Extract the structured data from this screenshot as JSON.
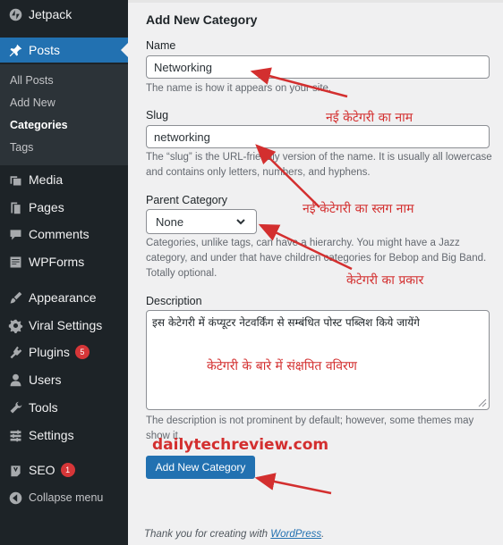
{
  "sidebar": {
    "items": [
      {
        "label": "Jetpack",
        "icon": "jetpack-icon"
      },
      {
        "label": "Posts",
        "icon": "pin-icon"
      },
      {
        "label": "Media",
        "icon": "media-icon"
      },
      {
        "label": "Pages",
        "icon": "pages-icon"
      },
      {
        "label": "Comments",
        "icon": "comments-icon"
      },
      {
        "label": "WPForms",
        "icon": "wpforms-icon"
      },
      {
        "label": "Appearance",
        "icon": "brush-icon"
      },
      {
        "label": "Viral Settings",
        "icon": "gear-icon"
      },
      {
        "label": "Plugins",
        "icon": "plugin-icon",
        "badge": "5"
      },
      {
        "label": "Users",
        "icon": "users-icon"
      },
      {
        "label": "Tools",
        "icon": "wrench-icon"
      },
      {
        "label": "Settings",
        "icon": "settings-icon"
      },
      {
        "label": "SEO",
        "icon": "yoast-icon",
        "badge": "1"
      },
      {
        "label": "Collapse menu",
        "icon": "collapse-icon"
      }
    ],
    "posts_submenu": [
      "All Posts",
      "Add New",
      "Categories",
      "Tags"
    ],
    "active_item": "Posts",
    "current_submenu": "Categories"
  },
  "form": {
    "title": "Add New Category",
    "name_label": "Name",
    "name_value": "Networking",
    "name_help": "The name is how it appears on your site.",
    "slug_label": "Slug",
    "slug_value": "networking",
    "slug_help": "The “slug” is the URL-friendly version of the name. It is usually all lowercase and contains only letters, numbers, and hyphens.",
    "parent_label": "Parent Category",
    "parent_value": "None",
    "parent_help": "Categories, unlike tags, can have a hierarchy. You might have a Jazz category, and under that have children categories for Bebop and Big Band. Totally optional.",
    "description_label": "Description",
    "description_value": "इस केटेगरी में कंप्यूटर नेटवर्किंग से सम्बंधित पोस्ट पब्लिश किये जायेंगे",
    "description_help": "The description is not prominent by default; however, some themes may show it.",
    "submit_label": "Add New Category"
  },
  "footer": {
    "prefix": "Thank you for creating with ",
    "link": "WordPress",
    "suffix": "."
  },
  "annotations": {
    "name_note": "नई केटेगरी का नाम",
    "slug_note": "नई  केटेगरी का स्लग नाम",
    "parent_note": "केटेगरी का प्रकार",
    "description_note": "केटेगरी के बारे में संक्षपित वविरण",
    "site": "dailytechreview.com"
  },
  "colors": {
    "sidebar_bg": "#1d2327",
    "active_bg": "#2271b1",
    "annotation": "#d32f2f",
    "badge": "#d63638"
  }
}
